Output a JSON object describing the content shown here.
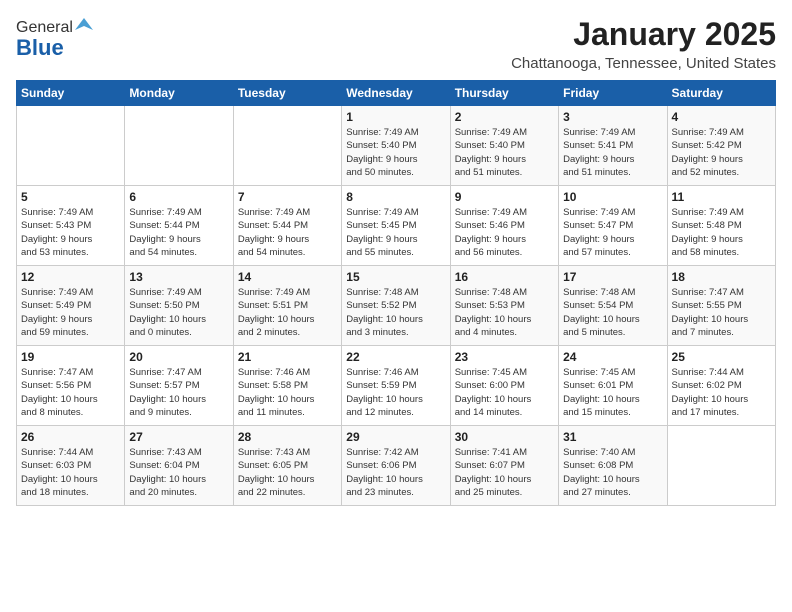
{
  "header": {
    "logo_general": "General",
    "logo_blue": "Blue",
    "month": "January 2025",
    "location": "Chattanooga, Tennessee, United States"
  },
  "days_of_week": [
    "Sunday",
    "Monday",
    "Tuesday",
    "Wednesday",
    "Thursday",
    "Friday",
    "Saturday"
  ],
  "weeks": [
    [
      {
        "day": "",
        "info": ""
      },
      {
        "day": "",
        "info": ""
      },
      {
        "day": "",
        "info": ""
      },
      {
        "day": "1",
        "info": "Sunrise: 7:49 AM\nSunset: 5:40 PM\nDaylight: 9 hours\nand 50 minutes."
      },
      {
        "day": "2",
        "info": "Sunrise: 7:49 AM\nSunset: 5:40 PM\nDaylight: 9 hours\nand 51 minutes."
      },
      {
        "day": "3",
        "info": "Sunrise: 7:49 AM\nSunset: 5:41 PM\nDaylight: 9 hours\nand 51 minutes."
      },
      {
        "day": "4",
        "info": "Sunrise: 7:49 AM\nSunset: 5:42 PM\nDaylight: 9 hours\nand 52 minutes."
      }
    ],
    [
      {
        "day": "5",
        "info": "Sunrise: 7:49 AM\nSunset: 5:43 PM\nDaylight: 9 hours\nand 53 minutes."
      },
      {
        "day": "6",
        "info": "Sunrise: 7:49 AM\nSunset: 5:44 PM\nDaylight: 9 hours\nand 54 minutes."
      },
      {
        "day": "7",
        "info": "Sunrise: 7:49 AM\nSunset: 5:44 PM\nDaylight: 9 hours\nand 54 minutes."
      },
      {
        "day": "8",
        "info": "Sunrise: 7:49 AM\nSunset: 5:45 PM\nDaylight: 9 hours\nand 55 minutes."
      },
      {
        "day": "9",
        "info": "Sunrise: 7:49 AM\nSunset: 5:46 PM\nDaylight: 9 hours\nand 56 minutes."
      },
      {
        "day": "10",
        "info": "Sunrise: 7:49 AM\nSunset: 5:47 PM\nDaylight: 9 hours\nand 57 minutes."
      },
      {
        "day": "11",
        "info": "Sunrise: 7:49 AM\nSunset: 5:48 PM\nDaylight: 9 hours\nand 58 minutes."
      }
    ],
    [
      {
        "day": "12",
        "info": "Sunrise: 7:49 AM\nSunset: 5:49 PM\nDaylight: 9 hours\nand 59 minutes."
      },
      {
        "day": "13",
        "info": "Sunrise: 7:49 AM\nSunset: 5:50 PM\nDaylight: 10 hours\nand 0 minutes."
      },
      {
        "day": "14",
        "info": "Sunrise: 7:49 AM\nSunset: 5:51 PM\nDaylight: 10 hours\nand 2 minutes."
      },
      {
        "day": "15",
        "info": "Sunrise: 7:48 AM\nSunset: 5:52 PM\nDaylight: 10 hours\nand 3 minutes."
      },
      {
        "day": "16",
        "info": "Sunrise: 7:48 AM\nSunset: 5:53 PM\nDaylight: 10 hours\nand 4 minutes."
      },
      {
        "day": "17",
        "info": "Sunrise: 7:48 AM\nSunset: 5:54 PM\nDaylight: 10 hours\nand 5 minutes."
      },
      {
        "day": "18",
        "info": "Sunrise: 7:47 AM\nSunset: 5:55 PM\nDaylight: 10 hours\nand 7 minutes."
      }
    ],
    [
      {
        "day": "19",
        "info": "Sunrise: 7:47 AM\nSunset: 5:56 PM\nDaylight: 10 hours\nand 8 minutes."
      },
      {
        "day": "20",
        "info": "Sunrise: 7:47 AM\nSunset: 5:57 PM\nDaylight: 10 hours\nand 9 minutes."
      },
      {
        "day": "21",
        "info": "Sunrise: 7:46 AM\nSunset: 5:58 PM\nDaylight: 10 hours\nand 11 minutes."
      },
      {
        "day": "22",
        "info": "Sunrise: 7:46 AM\nSunset: 5:59 PM\nDaylight: 10 hours\nand 12 minutes."
      },
      {
        "day": "23",
        "info": "Sunrise: 7:45 AM\nSunset: 6:00 PM\nDaylight: 10 hours\nand 14 minutes."
      },
      {
        "day": "24",
        "info": "Sunrise: 7:45 AM\nSunset: 6:01 PM\nDaylight: 10 hours\nand 15 minutes."
      },
      {
        "day": "25",
        "info": "Sunrise: 7:44 AM\nSunset: 6:02 PM\nDaylight: 10 hours\nand 17 minutes."
      }
    ],
    [
      {
        "day": "26",
        "info": "Sunrise: 7:44 AM\nSunset: 6:03 PM\nDaylight: 10 hours\nand 18 minutes."
      },
      {
        "day": "27",
        "info": "Sunrise: 7:43 AM\nSunset: 6:04 PM\nDaylight: 10 hours\nand 20 minutes."
      },
      {
        "day": "28",
        "info": "Sunrise: 7:43 AM\nSunset: 6:05 PM\nDaylight: 10 hours\nand 22 minutes."
      },
      {
        "day": "29",
        "info": "Sunrise: 7:42 AM\nSunset: 6:06 PM\nDaylight: 10 hours\nand 23 minutes."
      },
      {
        "day": "30",
        "info": "Sunrise: 7:41 AM\nSunset: 6:07 PM\nDaylight: 10 hours\nand 25 minutes."
      },
      {
        "day": "31",
        "info": "Sunrise: 7:40 AM\nSunset: 6:08 PM\nDaylight: 10 hours\nand 27 minutes."
      },
      {
        "day": "",
        "info": ""
      }
    ]
  ]
}
